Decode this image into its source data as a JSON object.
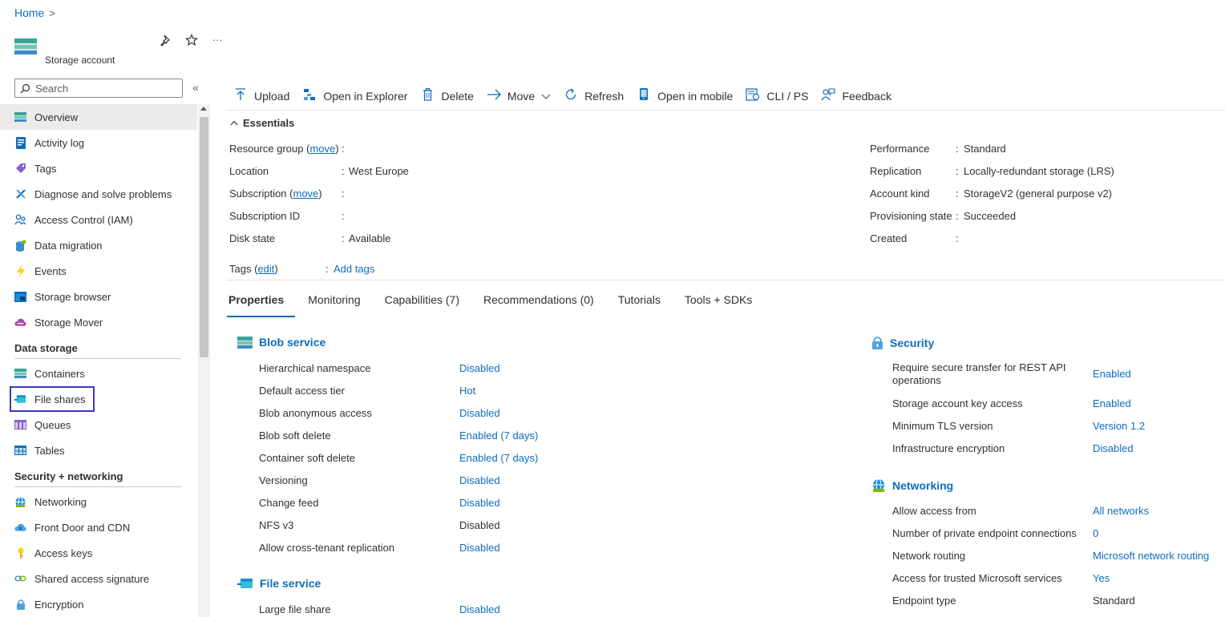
{
  "breadcrumb": {
    "home": "Home",
    "separator": ">"
  },
  "resource": {
    "subtitle": "Storage account",
    "icon": "storage-account-icon"
  },
  "title_actions": {
    "pin": "pin-icon",
    "favorite": "star-icon",
    "more": "···"
  },
  "sidebar": {
    "search_placeholder": "Search",
    "collapse": "«",
    "items_top": [
      {
        "label": "Overview",
        "icon": "overview-icon",
        "active": true
      },
      {
        "label": "Activity log",
        "icon": "activity-log-icon"
      },
      {
        "label": "Tags",
        "icon": "tag-icon"
      },
      {
        "label": "Diagnose and solve problems",
        "icon": "wrench-icon"
      },
      {
        "label": "Access Control (IAM)",
        "icon": "people-icon"
      },
      {
        "label": "Data migration",
        "icon": "data-migration-icon"
      },
      {
        "label": "Events",
        "icon": "lightning-icon"
      },
      {
        "label": "Storage browser",
        "icon": "storage-browser-icon"
      },
      {
        "label": "Storage Mover",
        "icon": "cloud-icon"
      }
    ],
    "group_data_storage": "Data storage",
    "items_data_storage": [
      {
        "label": "Containers",
        "icon": "containers-icon"
      },
      {
        "label": "File shares",
        "icon": "file-shares-icon"
      },
      {
        "label": "Queues",
        "icon": "queues-icon"
      },
      {
        "label": "Tables",
        "icon": "tables-icon"
      }
    ],
    "group_security": "Security + networking",
    "items_security": [
      {
        "label": "Networking",
        "icon": "networking-icon"
      },
      {
        "label": "Front Door and CDN",
        "icon": "cdn-icon"
      },
      {
        "label": "Access keys",
        "icon": "key-icon"
      },
      {
        "label": "Shared access signature",
        "icon": "link-icon"
      },
      {
        "label": "Encryption",
        "icon": "lock-icon"
      }
    ]
  },
  "toolbar": {
    "upload": "Upload",
    "open_explorer": "Open in Explorer",
    "delete": "Delete",
    "move": "Move",
    "refresh": "Refresh",
    "open_mobile": "Open in mobile",
    "cli_ps": "CLI / PS",
    "feedback": "Feedback"
  },
  "essentials": {
    "title": "Essentials",
    "left": [
      {
        "key": "Resource group",
        "link": "move",
        "value": ""
      },
      {
        "key": "Location",
        "value": "West Europe"
      },
      {
        "key": "Subscription",
        "link": "move",
        "value": ""
      },
      {
        "key": "Subscription ID",
        "value": ""
      },
      {
        "key": "Disk state",
        "value": "Available"
      }
    ],
    "right": [
      {
        "key": "Performance",
        "value": "Standard"
      },
      {
        "key": "Replication",
        "value": "Locally-redundant storage (LRS)"
      },
      {
        "key": "Account kind",
        "value": "StorageV2 (general purpose v2)"
      },
      {
        "key": "Provisioning state",
        "value": "Succeeded"
      },
      {
        "key": "Created",
        "value": ""
      }
    ],
    "tags_key": "Tags",
    "tags_link": "edit",
    "tags_value": "Add tags"
  },
  "tabs": [
    "Properties",
    "Monitoring",
    "Capabilities (7)",
    "Recommendations (0)",
    "Tutorials",
    "Tools + SDKs"
  ],
  "blob_service": {
    "title": "Blob service",
    "rows": [
      {
        "label": "Hierarchical namespace",
        "value": "Disabled",
        "link": true
      },
      {
        "label": "Default access tier",
        "value": "Hot",
        "link": true
      },
      {
        "label": "Blob anonymous access",
        "value": "Disabled",
        "link": true
      },
      {
        "label": "Blob soft delete",
        "value": "Enabled (7 days)",
        "link": true
      },
      {
        "label": "Container soft delete",
        "value": "Enabled (7 days)",
        "link": true
      },
      {
        "label": "Versioning",
        "value": "Disabled",
        "link": true
      },
      {
        "label": "Change feed",
        "value": "Disabled",
        "link": true
      },
      {
        "label": "NFS v3",
        "value": "Disabled",
        "link": false
      },
      {
        "label": "Allow cross-tenant replication",
        "value": "Disabled",
        "link": true
      }
    ]
  },
  "file_service": {
    "title": "File service",
    "rows": [
      {
        "label": "Large file share",
        "value": "Disabled",
        "link": true
      }
    ]
  },
  "security": {
    "title": "Security",
    "rows": [
      {
        "label": "Require secure transfer for REST API operations",
        "value": "Enabled",
        "link": true
      },
      {
        "label": "Storage account key access",
        "value": "Enabled",
        "link": true
      },
      {
        "label": "Minimum TLS version",
        "value": "Version 1.2",
        "link": true
      },
      {
        "label": "Infrastructure encryption",
        "value": "Disabled",
        "link": true
      }
    ]
  },
  "networking": {
    "title": "Networking",
    "rows": [
      {
        "label": "Allow access from",
        "value": "All networks",
        "link": true
      },
      {
        "label": "Number of private endpoint connections",
        "value": "0",
        "link": true
      },
      {
        "label": "Network routing",
        "value": "Microsoft network routing",
        "link": true
      },
      {
        "label": "Access for trusted Microsoft services",
        "value": "Yes",
        "link": true
      },
      {
        "label": "Endpoint type",
        "value": "Standard",
        "link": false
      }
    ]
  },
  "colors": {
    "accent": "#0f6cbd",
    "focus": "#3a3ab8",
    "active_nav": "#edebe9"
  }
}
